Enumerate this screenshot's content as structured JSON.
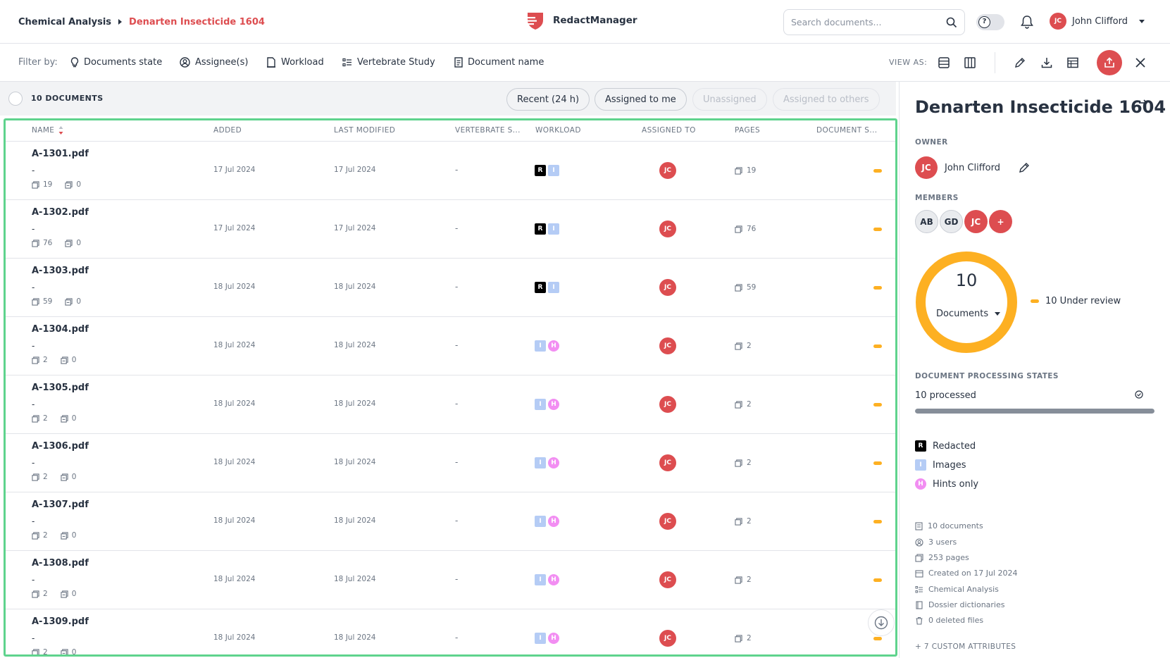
{
  "breadcrumb": {
    "parent": "Chemical Analysis",
    "current": "Denarten Insecticide 1604"
  },
  "brand": {
    "name": "RedactManager",
    "color": "#dd4d50"
  },
  "search": {
    "placeholder": "Search documents..."
  },
  "help_toggle": {
    "icon": "question-icon",
    "label": "?"
  },
  "user": {
    "initials": "JC",
    "name": "John Clifford"
  },
  "filter_bar": {
    "label": "Filter by:",
    "filters": [
      "Documents state",
      "Assignee(s)",
      "Workload",
      "Vertebrate Study",
      "Document name"
    ],
    "view_as_label": "VIEW AS:"
  },
  "list": {
    "count_label": "10 DOCUMENTS",
    "quick_filters": [
      {
        "label": "Recent (24 h)",
        "enabled": true
      },
      {
        "label": "Assigned to me",
        "enabled": true
      },
      {
        "label": "Unassigned",
        "enabled": false
      },
      {
        "label": "Assigned to others",
        "enabled": false
      }
    ],
    "columns": [
      "NAME",
      "ADDED",
      "LAST MODIFIED",
      "VERTEBRATE S...",
      "WORKLOAD",
      "ASSIGNED TO",
      "PAGES",
      "DOCUMENT S..."
    ],
    "rows": [
      {
        "name": "A-1301.pdf",
        "sub": "-",
        "pages_count": "19",
        "excluded": "0",
        "added": "17 Jul 2024",
        "modified": "17 Jul 2024",
        "vertebrate": "-",
        "workload": [
          "R",
          "I"
        ],
        "assignee": "JC",
        "pages": "19"
      },
      {
        "name": "A-1302.pdf",
        "sub": "-",
        "pages_count": "76",
        "excluded": "0",
        "added": "17 Jul 2024",
        "modified": "17 Jul 2024",
        "vertebrate": "-",
        "workload": [
          "R",
          "I"
        ],
        "assignee": "JC",
        "pages": "76"
      },
      {
        "name": "A-1303.pdf",
        "sub": "-",
        "pages_count": "59",
        "excluded": "0",
        "added": "18 Jul 2024",
        "modified": "18 Jul 2024",
        "vertebrate": "-",
        "workload": [
          "R",
          "I"
        ],
        "assignee": "JC",
        "pages": "59"
      },
      {
        "name": "A-1304.pdf",
        "sub": "-",
        "pages_count": "2",
        "excluded": "0",
        "added": "18 Jul 2024",
        "modified": "18 Jul 2024",
        "vertebrate": "-",
        "workload": [
          "I",
          "H"
        ],
        "assignee": "JC",
        "pages": "2"
      },
      {
        "name": "A-1305.pdf",
        "sub": "-",
        "pages_count": "2",
        "excluded": "0",
        "added": "18 Jul 2024",
        "modified": "18 Jul 2024",
        "vertebrate": "-",
        "workload": [
          "I",
          "H"
        ],
        "assignee": "JC",
        "pages": "2"
      },
      {
        "name": "A-1306.pdf",
        "sub": "-",
        "pages_count": "2",
        "excluded": "0",
        "added": "18 Jul 2024",
        "modified": "18 Jul 2024",
        "vertebrate": "-",
        "workload": [
          "I",
          "H"
        ],
        "assignee": "JC",
        "pages": "2"
      },
      {
        "name": "A-1307.pdf",
        "sub": "-",
        "pages_count": "2",
        "excluded": "0",
        "added": "18 Jul 2024",
        "modified": "18 Jul 2024",
        "vertebrate": "-",
        "workload": [
          "I",
          "H"
        ],
        "assignee": "JC",
        "pages": "2"
      },
      {
        "name": "A-1308.pdf",
        "sub": "-",
        "pages_count": "2",
        "excluded": "0",
        "added": "18 Jul 2024",
        "modified": "18 Jul 2024",
        "vertebrate": "-",
        "workload": [
          "I",
          "H"
        ],
        "assignee": "JC",
        "pages": "2"
      },
      {
        "name": "A-1309.pdf",
        "sub": "-",
        "pages_count": "2",
        "excluded": "0",
        "added": "18 Jul 2024",
        "modified": "18 Jul 2024",
        "vertebrate": "-",
        "workload": [
          "I",
          "H"
        ],
        "assignee": "JC",
        "pages": "2"
      }
    ]
  },
  "panel": {
    "title": "Denarten Insecticide 1604",
    "owner_label": "OWNER",
    "owner": {
      "initials": "JC",
      "name": "John Clifford"
    },
    "members_label": "MEMBERS",
    "members": [
      "AB",
      "GD",
      "JC"
    ],
    "add_member": "+",
    "donut": {
      "total": "10",
      "label": "Documents",
      "under_review": 10
    },
    "under_review_label": "10 Under review",
    "processing_label": "DOCUMENT PROCESSING STATES",
    "processed_label": "10 processed",
    "processed_fraction": 1.0,
    "legend": [
      {
        "badge": "R",
        "label": "Redacted"
      },
      {
        "badge": "I",
        "label": "Images"
      },
      {
        "badge": "H",
        "label": "Hints only"
      }
    ],
    "stats": [
      "10 documents",
      "3 users",
      "253 pages",
      "Created on 17 Jul 2024",
      "Chemical Analysis",
      "Dossier dictionaries",
      "0 deleted files"
    ],
    "custom_attributes": "+ 7 CUSTOM ATTRIBUTES"
  },
  "colors": {
    "accent": "#dd4d50",
    "review": "#fdb022",
    "selection": "#5fd38d",
    "images": "#b5ccf5",
    "hints": "#f28ef2"
  }
}
